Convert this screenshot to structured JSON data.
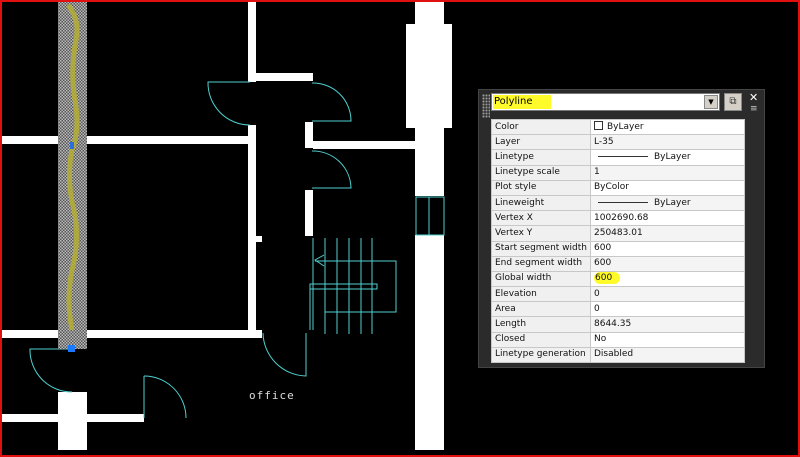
{
  "drawing": {
    "room_label": "office"
  },
  "properties": {
    "object_type": "Polyline",
    "rows": [
      {
        "label": "Color",
        "value": "ByLayer",
        "kind": "color"
      },
      {
        "label": "Layer",
        "value": "L-35"
      },
      {
        "label": "Linetype",
        "value": "ByLayer",
        "kind": "line"
      },
      {
        "label": "Linetype scale",
        "value": "1"
      },
      {
        "label": "Plot style",
        "value": "ByColor"
      },
      {
        "label": "Lineweight",
        "value": "ByLayer",
        "kind": "line"
      },
      {
        "label": "Vertex X",
        "value": "1002690.68"
      },
      {
        "label": "Vertex Y",
        "value": "250483.01"
      },
      {
        "label": "Start segment width",
        "value": "600"
      },
      {
        "label": "End segment width",
        "value": "600"
      },
      {
        "label": "Global width",
        "value": "600",
        "kind": "highlight"
      },
      {
        "label": "Elevation",
        "value": "0"
      },
      {
        "label": "Area",
        "value": "0"
      },
      {
        "label": "Length",
        "value": "8644.35"
      },
      {
        "label": "Closed",
        "value": "No"
      },
      {
        "label": "Linetype generation",
        "value": "Disabled"
      }
    ]
  },
  "colors": {
    "wall": "#ffffff",
    "door": "#4fd0d0",
    "highlight": "#fffb2a",
    "frame": "#e01010"
  }
}
